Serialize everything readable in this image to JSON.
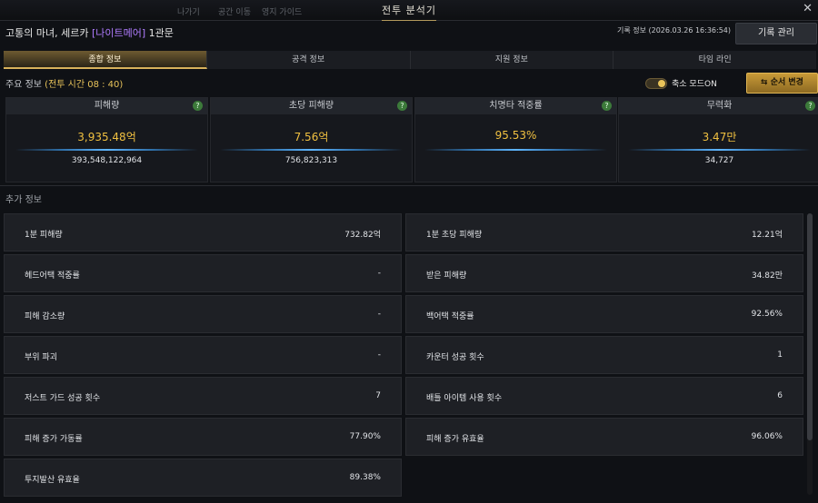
{
  "window": {
    "title": "전투 분석기",
    "close_label": "✕"
  },
  "topbar_faded": [
    "나가기",
    "공간 이동",
    "영지 가이드"
  ],
  "header": {
    "boss_prefix": "고통의 마녀, 세르카 ",
    "boss_tag": "[나이트메어]",
    "boss_suffix": " 1관문",
    "record_info": "기록 정보 (2026.03.26 16:36:54)",
    "record_button": "기록 관리"
  },
  "tabs": [
    {
      "label": "종합 정보",
      "active": true
    },
    {
      "label": "공격 정보",
      "active": false
    },
    {
      "label": "지원 정보",
      "active": false
    },
    {
      "label": "타임 라인",
      "active": false
    }
  ],
  "main_info": {
    "label": "주요 정보",
    "time": "(전투 시간 08 : 40)",
    "toggle_label": "축소 모드ON",
    "order_button": "순서 변경"
  },
  "stats": [
    {
      "title": "피해량",
      "big": "3,935.48억",
      "small": "393,548,122,964"
    },
    {
      "title": "초당 피해량",
      "big": "7.56억",
      "small": "756,823,313"
    },
    {
      "title": "치명타 적중률",
      "big": "95.53%",
      "small": ""
    },
    {
      "title": "무력화",
      "big": "3.47만",
      "small": "34,727"
    }
  ],
  "extra_info_title": "추가 정보",
  "rows": [
    {
      "label": "1분 피해량",
      "value": "732.82억"
    },
    {
      "label": "1분 초당 피해량",
      "value": "12.21억"
    },
    {
      "label": "헤드어택 적중률",
      "value": "-"
    },
    {
      "label": "받은 피해량",
      "value": "34.82만"
    },
    {
      "label": "피해 감소량",
      "value": "-"
    },
    {
      "label": "백어택 적중률",
      "value": "92.56%"
    },
    {
      "label": "부위 파괴",
      "value": "-"
    },
    {
      "label": "카운터 성공 횟수",
      "value": "1"
    },
    {
      "label": "저스트 가드 성공 횟수",
      "value": "7"
    },
    {
      "label": "배틀 아이템 사용 횟수",
      "value": "6"
    },
    {
      "label": "피해 증가 가동률",
      "value": "77.90%"
    },
    {
      "label": "피해 증가 유효율",
      "value": "96.06%"
    },
    {
      "label": "투지발산 유효율",
      "value": "89.38%"
    }
  ],
  "colors": {
    "accent_gold": "#e8c35a",
    "tag_purple": "#b07cff",
    "value_gold": "#f0c040"
  }
}
